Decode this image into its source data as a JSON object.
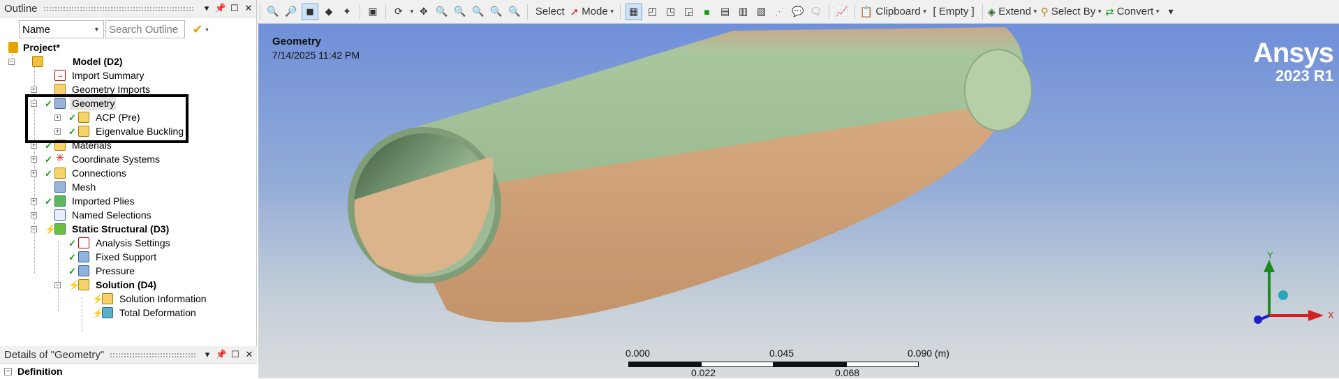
{
  "outline": {
    "title": "Outline",
    "filter_by": "Name",
    "search_placeholder": "Search Outline"
  },
  "tree": {
    "project": "Project*",
    "model": "Model (D2)",
    "import_summary": "Import Summary",
    "geometry_imports": "Geometry Imports",
    "geometry": "Geometry",
    "acp_pre": "ACP (Pre)",
    "eigenvalue_buckling": "Eigenvalue Buckling",
    "materials": "Materials",
    "coordinate_systems": "Coordinate Systems",
    "connections": "Connections",
    "mesh": "Mesh",
    "imported_plies": "Imported Plies",
    "named_selections": "Named Selections",
    "static_structural": "Static Structural (D3)",
    "analysis_settings": "Analysis Settings",
    "fixed_support": "Fixed Support",
    "pressure": "Pressure",
    "solution": "Solution (D4)",
    "solution_information": "Solution Information",
    "total_deformation": "Total Deformation"
  },
  "details": {
    "title": "Details of \"Geometry\"",
    "section": "Definition"
  },
  "toolbar": {
    "select": "Select",
    "mode": "Mode",
    "clipboard": "Clipboard",
    "empty": "[ Empty ]",
    "extend": "Extend",
    "select_by": "Select By",
    "convert": "Convert"
  },
  "viewport": {
    "title": "Geometry",
    "timestamp": "7/14/2025 11:42 PM",
    "brand": "Ansys",
    "version": "2023 R1",
    "scale_labels": [
      "0.000",
      "0.045",
      "0.090 (m)",
      "0.022",
      "0.068"
    ],
    "axis_x": "X",
    "axis_y": "Y"
  },
  "colors": {
    "check": "#0f9d0f",
    "bolt": "#e6b400",
    "tube_green": "#9fc79a",
    "tube_tan": "#d4a57a",
    "axis_x": "#d42020",
    "axis_y": "#1a8a1a",
    "axis_z": "#2020c8"
  }
}
